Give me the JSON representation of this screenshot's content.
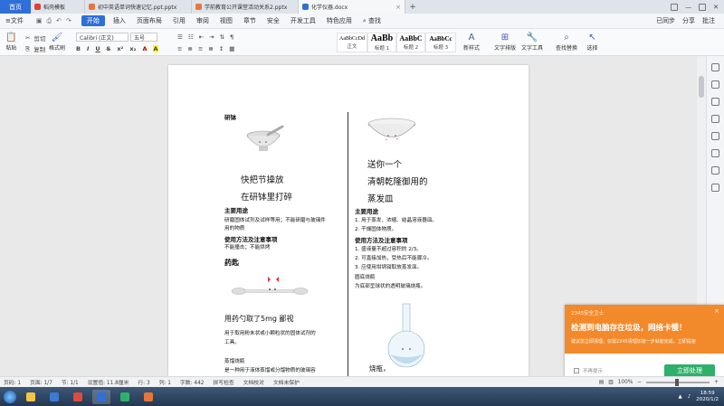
{
  "tabs": {
    "home": "首页",
    "items": [
      {
        "label": "稻壳模板",
        "color": "red"
      },
      {
        "label": "初中英语单词快速记忆.ppt.pptx",
        "color": "orange"
      },
      {
        "label": "学前教育公开课堂活动关系2.pptx",
        "color": "orange"
      },
      {
        "label": "化学仪器.docx",
        "color": "blue",
        "active": true
      }
    ],
    "login": "已同步"
  },
  "menu": {
    "file": "文件",
    "items": [
      "开始",
      "插入",
      "页面布局",
      "引用",
      "审阅",
      "视图",
      "章节",
      "安全",
      "开发工具",
      "特色应用"
    ],
    "search": "查找",
    "right": [
      "已同步",
      "分享",
      "批注"
    ]
  },
  "ribbon": {
    "paste": "粘贴",
    "cut": "剪切",
    "copy": "复制",
    "format_painter": "格式刷",
    "font_name": "Calibri (正文)",
    "font_size": "五号",
    "bold": "B",
    "italic": "I",
    "underline": "U",
    "styles": [
      {
        "sample": "AaBbCcDd",
        "name": "正文"
      },
      {
        "sample": "AaBb",
        "name": "标题 1"
      },
      {
        "sample": "AaBbC",
        "name": "标题 2"
      },
      {
        "sample": "AaBbCc",
        "name": "标题 3"
      }
    ],
    "new_style": "新样式",
    "text_layout": "文字排版",
    "text_tools": "文字工具",
    "find_replace": "查找替换",
    "select": "选择"
  },
  "doc": {
    "left": {
      "head": "研钵",
      "poem1": "快把节操放",
      "poem2": "在研钵里打碎",
      "use_title": "主要用途",
      "use_text1": "研磨固体试剂及试样等用；不能研磨与玻璃件",
      "use_text2": "用的物质",
      "note_title": "使用方法及注意事项",
      "note_text": "不能撞击；不能烘烤",
      "spoon_head": "药匙",
      "spoon_caption": "用药勺取了5mg  鄙视",
      "spoon_text1": "用于取用粉末状或小颗粒状的固体试剂的",
      "spoon_text2": "工具。",
      "flask_head": "蒸馏烧瓶",
      "flask_text": "是一种用于液体蒸馏或分馏物质的玻璃容"
    },
    "right": {
      "poem1": "送你一个",
      "poem2": "清朝乾隆御用的",
      "poem3": "蒸发皿",
      "use_title": "主要用途",
      "use_1": "1.  用于蒸发、浓缩、结晶溶液器皿。",
      "use_2": "2.  干燥固体物质。",
      "note_title": "使用方法及注意事项",
      "note_1": "1.  盛液量不超过容积的 2/3。",
      "note_2": "2.  可直接加热，受热后不能骤冷。",
      "note_3": "3.  应使用坩埚钳取放蒸发皿。",
      "rb_head": "圆底烧瓶",
      "rb_text": "为底部呈球状的透明玻璃烧瓶。",
      "rb_caption": "烧瓶，"
    }
  },
  "notice": {
    "app": "2345安全卫士",
    "title": "检测到电脑存在垃圾，网络卡慢！",
    "desc": "建议您立即清理，仅需2345清理加速一步就能完成，立即提速",
    "dont_remind": "不再提示",
    "action": "立即处理"
  },
  "status": {
    "page_no": "页码: 1",
    "page": "页面: 1/7",
    "section": "节: 1/1",
    "position": "设置值: 11.8厘米",
    "row": "行: 3",
    "col": "列: 1",
    "words": "字数: 442",
    "spell": "拼写检查",
    "proof": "文档校对",
    "protect": "文档未保护",
    "zoom": "100%"
  },
  "taskbar": {
    "time": "18:59",
    "date": "2020/1/2"
  }
}
